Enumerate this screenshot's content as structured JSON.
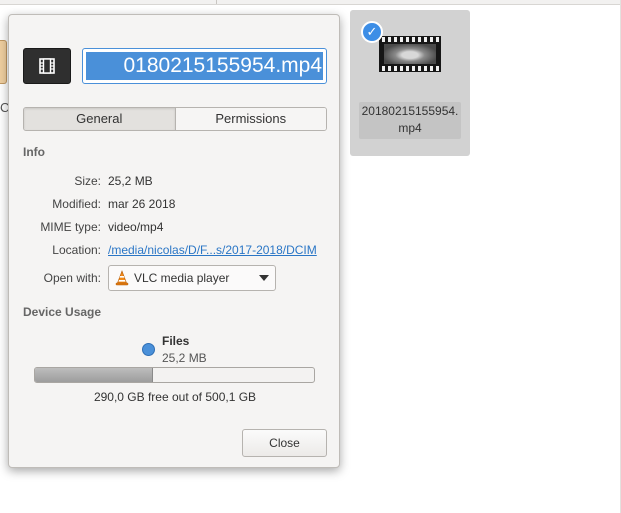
{
  "background": {
    "selected_file": {
      "name": "20180215155954.mp4",
      "icon": "video-thumbnail",
      "selected": true
    },
    "partial_left_char": "C"
  },
  "dialog": {
    "file_type_icon": "film-icon",
    "filename_field_value": "0180215155954.mp4",
    "tabs": [
      {
        "label": "General",
        "active": true
      },
      {
        "label": "Permissions",
        "active": false
      }
    ],
    "info": {
      "title": "Info",
      "rows": {
        "size": {
          "label": "Size:",
          "value": "25,2 MB"
        },
        "modified": {
          "label": "Modified:",
          "value": "mar 26 2018"
        },
        "mime": {
          "label": "MIME type:",
          "value": "video/mp4"
        },
        "location": {
          "label": "Location:",
          "value": "/media/nicolas/D/F...s/2017-2018/DCIM"
        },
        "open_with": {
          "label": "Open with:",
          "value": "VLC media player",
          "icon": "vlc-cone-icon"
        }
      }
    },
    "device_usage": {
      "title": "Device Usage",
      "legend_name": "Files",
      "legend_size": "25,2 MB",
      "used_fraction": 0.42,
      "free_text": "290,0 GB free out of 500,1 GB"
    },
    "close_label": "Close"
  },
  "colors": {
    "accent": "#4a90d9",
    "link": "#2a76c6",
    "dialog_bg": "#f5f4f3",
    "selection_tile": "#d2d2d2"
  }
}
